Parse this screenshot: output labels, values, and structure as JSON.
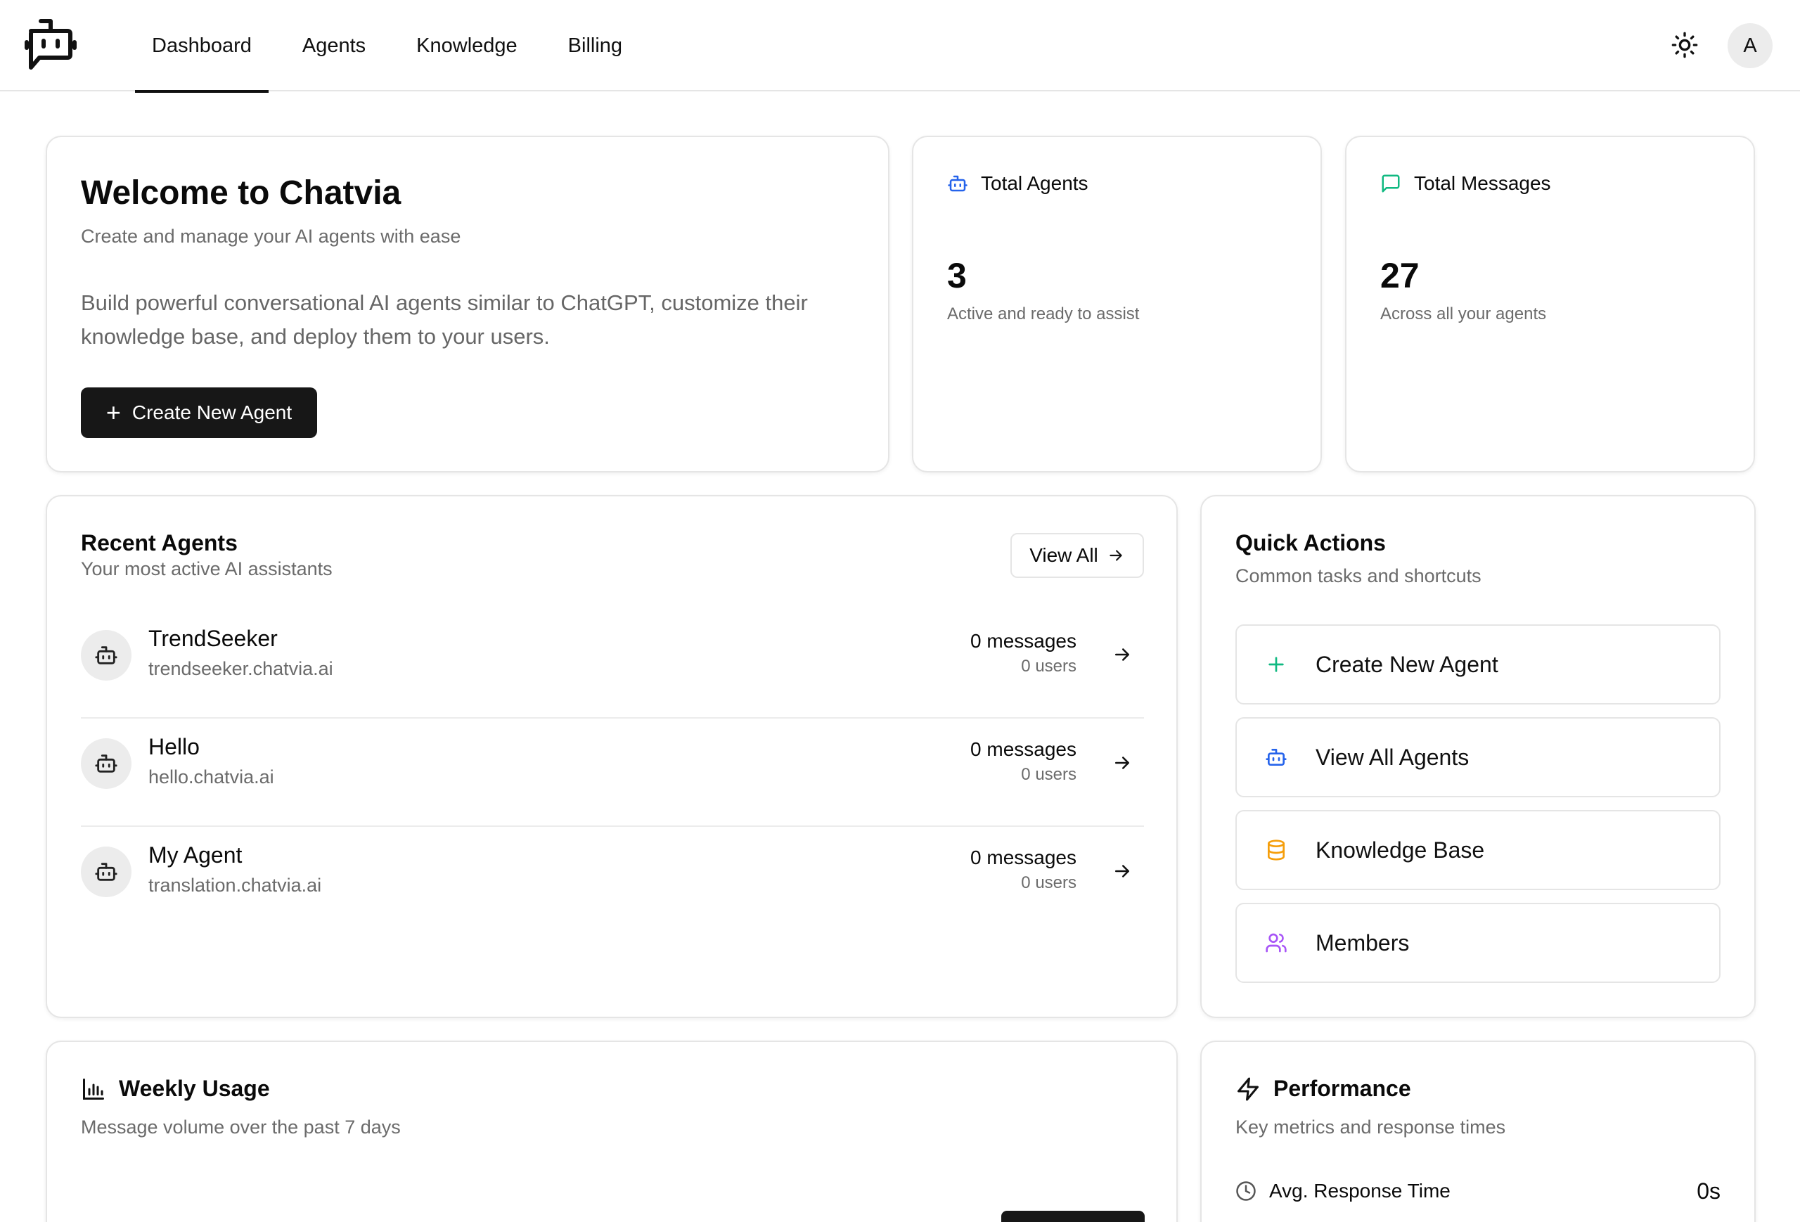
{
  "nav": {
    "items": [
      {
        "label": "Dashboard",
        "active": true
      },
      {
        "label": "Agents",
        "active": false
      },
      {
        "label": "Knowledge",
        "active": false
      },
      {
        "label": "Billing",
        "active": false
      }
    ],
    "avatar_initial": "A",
    "theme_icon": "sun-icon",
    "logo_icon": "bot-chat-logo-icon"
  },
  "welcome": {
    "title": "Welcome to Chatvia",
    "subtitle": "Create and manage your AI agents with ease",
    "description": "Build powerful conversational AI agents similar to ChatGPT, customize their knowledge base, and deploy them to your users.",
    "button_label": "Create New Agent"
  },
  "stats": {
    "agents": {
      "label": "Total Agents",
      "value": "3",
      "caption": "Active and ready to assist",
      "icon": "bot-icon",
      "icon_color": "#2563eb"
    },
    "messages": {
      "label": "Total Messages",
      "value": "27",
      "caption": "Across all your agents",
      "icon": "message-square-icon",
      "icon_color": "#10b981"
    }
  },
  "recent": {
    "title": "Recent Agents",
    "subtitle": "Your most active AI assistants",
    "view_all": "View All",
    "agents": [
      {
        "name": "TrendSeeker",
        "domain": "trendseeker.chatvia.ai",
        "messages": "0 messages",
        "users": "0 users"
      },
      {
        "name": "Hello",
        "domain": "hello.chatvia.ai",
        "messages": "0 messages",
        "users": "0 users"
      },
      {
        "name": "My Agent",
        "domain": "translation.chatvia.ai",
        "messages": "0 messages",
        "users": "0 users"
      }
    ]
  },
  "quick": {
    "title": "Quick Actions",
    "subtitle": "Common tasks and shortcuts",
    "actions": [
      {
        "label": "Create New Agent",
        "icon": "plus-icon",
        "color": "#10b981"
      },
      {
        "label": "View All Agents",
        "icon": "bot-icon",
        "color": "#2563eb"
      },
      {
        "label": "Knowledge Base",
        "icon": "database-icon",
        "color": "#f59e0b"
      },
      {
        "label": "Members",
        "icon": "users-icon",
        "color": "#a855f7"
      }
    ]
  },
  "weekly": {
    "title": "Weekly Usage",
    "subtitle": "Message volume over the past 7 days",
    "icon": "bar-chart-icon"
  },
  "performance": {
    "title": "Performance",
    "subtitle": "Key metrics and response times",
    "icon": "zap-icon",
    "metric_label": "Avg. Response Time",
    "metric_value": "0s",
    "metric_icon": "clock-icon"
  }
}
